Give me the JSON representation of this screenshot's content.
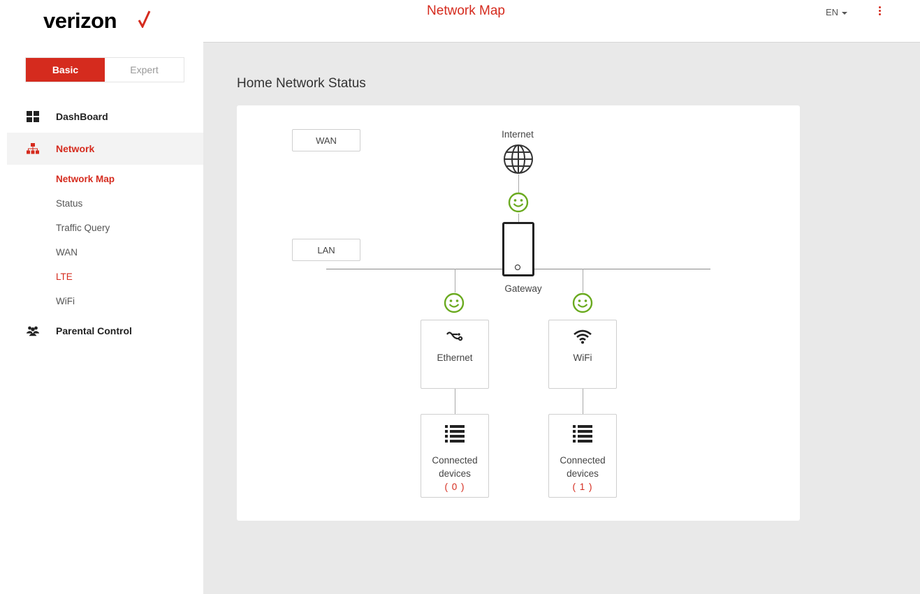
{
  "header": {
    "logo_text": "verizon",
    "brand_color": "#d52b1e",
    "page_title": "Network Map",
    "language": "EN",
    "menu_icon": "kebab-menu-icon"
  },
  "sidebar": {
    "mode_toggle": {
      "basic_label": "Basic",
      "expert_label": "Expert",
      "selected": "Basic"
    },
    "items": [
      {
        "label": "DashBoard",
        "icon": "dashboard-grid-icon"
      },
      {
        "label": "Network",
        "icon": "network-hierarchy-icon",
        "active": true
      },
      {
        "label": "Parental Control",
        "icon": "users-group-icon"
      }
    ],
    "network_subitems": [
      {
        "label": "Network Map",
        "current": true
      },
      {
        "label": "Status"
      },
      {
        "label": "Traffic Query"
      },
      {
        "label": "WAN"
      },
      {
        "label": "LTE",
        "highlight": true
      },
      {
        "label": "WiFi"
      }
    ]
  },
  "main": {
    "section_title": "Home Network Status",
    "map": {
      "wan_label": "WAN",
      "lan_label": "LAN",
      "internet_label": "Internet",
      "gateway_label": "Gateway",
      "status_color": "#6aaa1f",
      "internet_status_icon": "smiley-ok-icon",
      "ethernet": {
        "label": "Ethernet",
        "icon": "ethernet-cable-icon",
        "status_icon": "smiley-ok-icon"
      },
      "wifi": {
        "label": "WiFi",
        "icon": "wifi-icon",
        "status_icon": "smiley-ok-icon"
      },
      "ethernet_devices": {
        "line1": "Connected",
        "line2": "devices",
        "count": "( 0 )",
        "icon": "list-icon"
      },
      "wifi_devices": {
        "line1": "Connected",
        "line2": "devices",
        "count": "( 1 )",
        "icon": "list-icon"
      }
    }
  }
}
